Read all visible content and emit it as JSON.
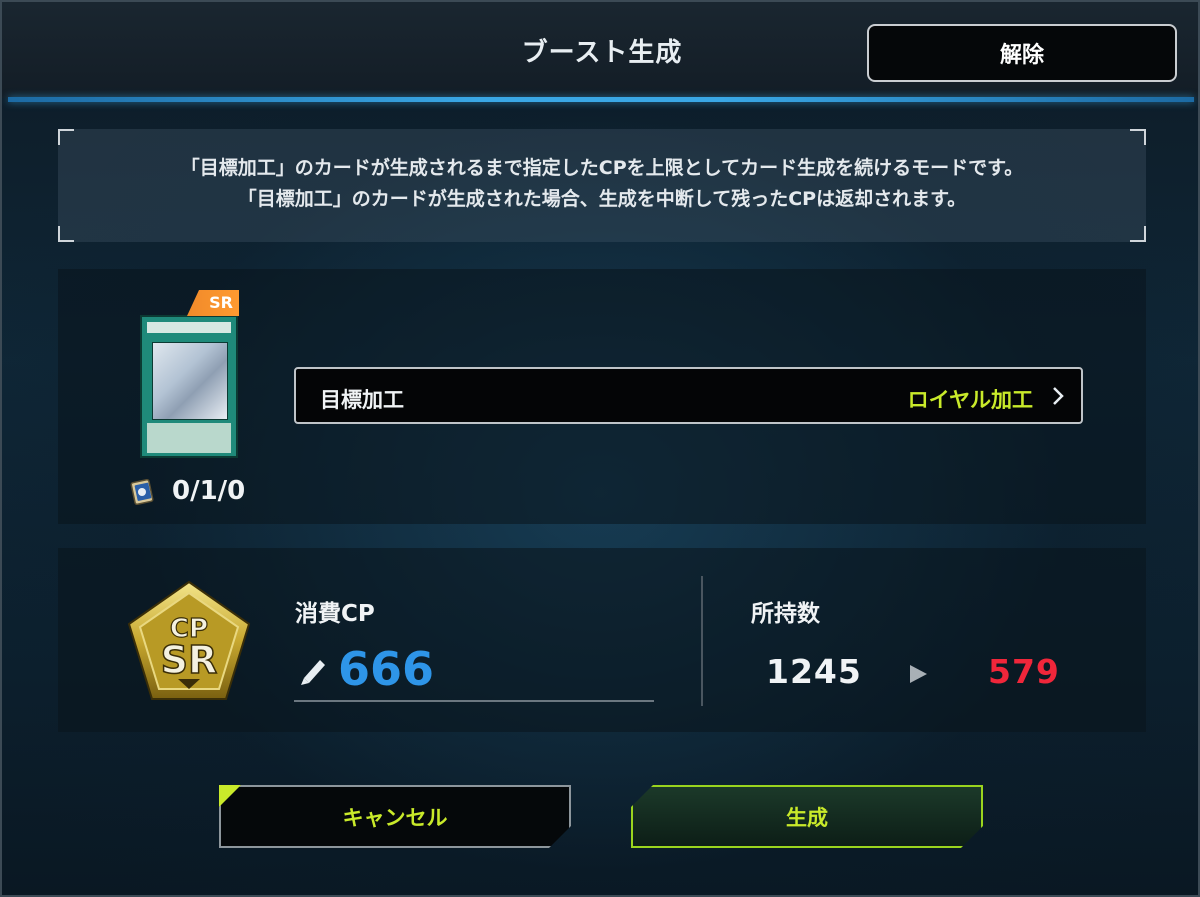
{
  "header": {
    "title": "ブースト生成",
    "release_label": "解除"
  },
  "notice": {
    "line1": "「目標加工」のカードが生成されるまで指定したCPを上限としてカード生成を続けるモードです。",
    "line2": "「目標加工」のカードが生成された場合、生成を中断して残ったCPは返却されます。"
  },
  "card": {
    "rarity_badge": "SR",
    "owned_counts": "0/1/0"
  },
  "target_finish": {
    "label": "目標加工",
    "value": "ロイヤル加工"
  },
  "cost": {
    "label": "消費CP",
    "value": "666",
    "emblem_top": "CP",
    "emblem_bottom": "SR"
  },
  "owned": {
    "label": "所持数",
    "before": "1245",
    "after": "579"
  },
  "buttons": {
    "cancel": "キャンセル",
    "generate": "生成"
  },
  "colors": {
    "accent_lime": "#c9ea2a",
    "cost_blue": "#2e95e8",
    "after_red": "#f0263a",
    "title_line_blue": "#3aa8e6",
    "sr_orange": "#f08a2a"
  }
}
